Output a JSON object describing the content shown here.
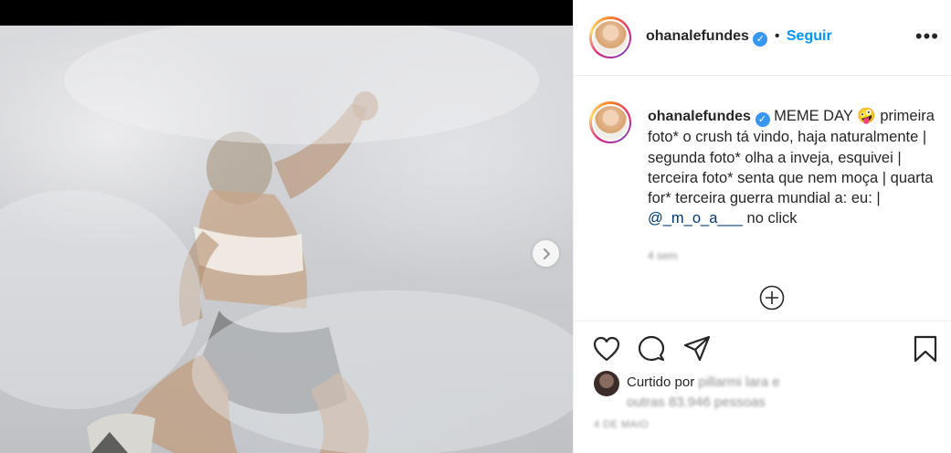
{
  "post": {
    "author": "ohanalefundes",
    "follow_label": "Seguir",
    "follow_separator": "•",
    "verified_icon": "✓",
    "more_icon": "•••",
    "caption_author": "ohanalefundes",
    "caption_title": "MEME DAY 🤪",
    "caption_body": "primeira foto* o crush tá vindo, haja naturalmente | segunda foto* olha a inveja, esquivei | terceira foto* senta que nem moça | quarta for* terceira guerra mundial a: eu: |",
    "caption_mention": "@_m_o_a___",
    "caption_tail": "no click",
    "caption_time": "4 sem",
    "liked_by": "Curtido por",
    "liked_blur_1": "pillarmi lara e",
    "liked_blur_2": "outras 83.946 pessoas",
    "post_date": "4 DE MAIO"
  },
  "icons": {
    "next": "chevron-right-icon",
    "add_comment": "plus-circle-icon",
    "like": "heart-icon",
    "comment": "comment-icon",
    "share": "send-icon",
    "save": "bookmark-icon"
  },
  "colors": {
    "follow": "#0095f6",
    "verified": "#3897f0",
    "mention": "#00376b",
    "muted": "#8e8e8e"
  }
}
